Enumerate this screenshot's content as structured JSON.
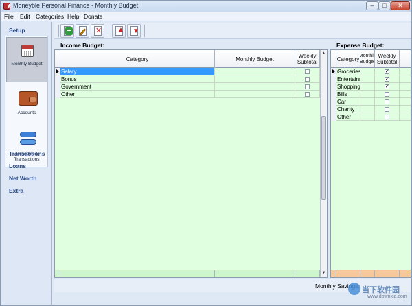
{
  "window": {
    "title": "Moneyble Personal Finance - Monthly Budget",
    "controls": {
      "minimize": "–",
      "maximize": "□",
      "close": "✕"
    }
  },
  "menu": [
    "File",
    "Edit",
    "Categories",
    "Help",
    "Donate"
  ],
  "nav": {
    "setup_label": "Setup",
    "tiles": [
      {
        "label": "Monthly Budget",
        "icon": "calendar-icon",
        "active": true
      },
      {
        "label": "Accounts",
        "icon": "wallet-icon",
        "active": false
      },
      {
        "label_line1": "Scheduled",
        "label_line2": "Transactions",
        "icon": "sync-icon",
        "active": false
      }
    ],
    "links": [
      "Transactions",
      "Loans",
      "Net Worth",
      "Extra"
    ]
  },
  "toolbar": {
    "buttons": [
      {
        "name": "add-category-button",
        "icon": "add-icon"
      },
      {
        "name": "edit-category-button",
        "icon": "edit-icon"
      },
      {
        "name": "delete-category-button",
        "icon": "delete-icon"
      },
      {
        "name": "move-up-button",
        "icon": "move-up-icon"
      },
      {
        "name": "move-down-button",
        "icon": "move-down-icon"
      }
    ]
  },
  "income": {
    "title": "Income Budget:",
    "headers": {
      "category": "Category",
      "monthly": "Monthly Budget",
      "weekly": "Weekly Subtotal"
    },
    "rows": [
      {
        "category": "Salary",
        "monthly": "",
        "weekly": false,
        "selected": true
      },
      {
        "category": "Bonus",
        "monthly": "",
        "weekly": false,
        "selected": false
      },
      {
        "category": "Government",
        "monthly": "",
        "weekly": false,
        "selected": false
      },
      {
        "category": "Other",
        "monthly": "",
        "weekly": false,
        "selected": false
      }
    ]
  },
  "expense": {
    "title": "Expense Budget:",
    "headers": {
      "category": "Category",
      "monthly": "Monthly Budget",
      "weekly": "Weekly Subtotal"
    },
    "rows": [
      {
        "category": "Groceries",
        "weekly": true
      },
      {
        "category": "Entertainment",
        "weekly": true
      },
      {
        "category": "Shopping",
        "weekly": true
      },
      {
        "category": "Bills",
        "weekly": false
      },
      {
        "category": "Car",
        "weekly": false
      },
      {
        "category": "Charity",
        "weekly": false
      },
      {
        "category": "Other",
        "weekly": false
      }
    ]
  },
  "footer": {
    "savings_label": "Monthly Savings:",
    "watermark_text": "当下软件园",
    "watermark_sub": "www.downxia.com"
  },
  "colors": {
    "income_grid": "#e0ffe0",
    "income_total": "#ccf5cc",
    "expense_total": "#f7c89a",
    "selection": "#3399ff"
  }
}
